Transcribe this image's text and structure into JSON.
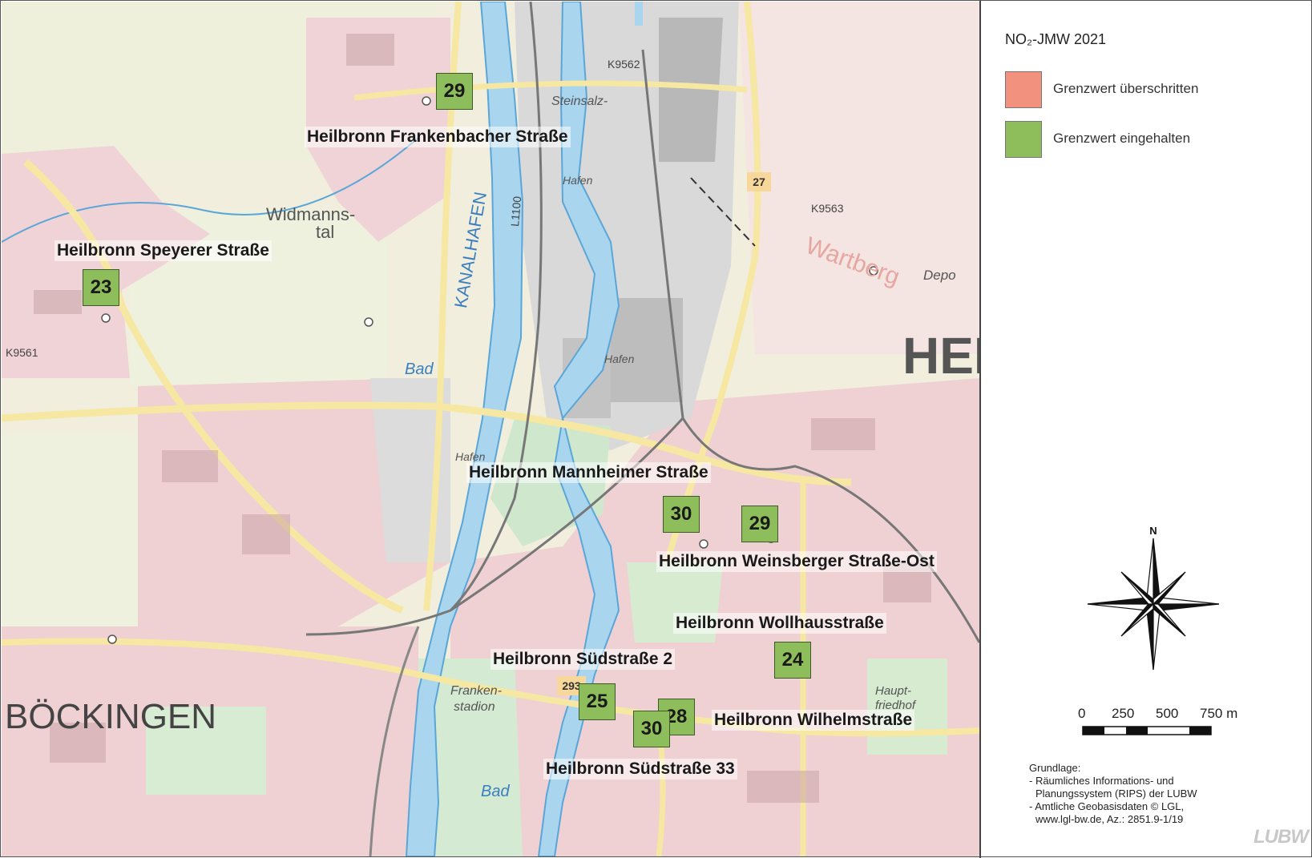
{
  "legend": {
    "title": "NO₂-JMW 2021",
    "items": [
      {
        "label": "Grenzwert überschritten",
        "color": "#f2917e"
      },
      {
        "label": "Grenzwert eingehalten",
        "color": "#8ebd5b"
      }
    ],
    "north": "N",
    "scale": {
      "ticks": [
        "0",
        "250",
        "500",
        "750 m"
      ]
    },
    "source_heading": "Grundlage:",
    "source_lines": [
      "- Räumliches Informations- und",
      "  Planungssystem (RIPS) der LUBW",
      "- Amtliche Geobasisdaten © LGL,",
      "  www.lgl-bw.de, Az.: 2851.9-1/19"
    ],
    "logo": "LUBW"
  },
  "stations": [
    {
      "name": "Heilbronn Frankenbacher Straße",
      "value": "29",
      "status": "Grenzwert eingehalten"
    },
    {
      "name": "Heilbronn Speyerer Straße",
      "value": "23",
      "status": "Grenzwert eingehalten"
    },
    {
      "name": "Heilbronn Mannheimer Straße",
      "value": "30",
      "status": "Grenzwert eingehalten"
    },
    {
      "name": "Heilbronn Weinsberger Straße-Ost",
      "value": "29",
      "status": "Grenzwert eingehalten"
    },
    {
      "name": "Heilbronn Wollhausstraße",
      "value": "24",
      "status": "Grenzwert eingehalten"
    },
    {
      "name": "Heilbronn Südstraße 2",
      "value": "25",
      "status": "Grenzwert eingehalten"
    },
    {
      "name": "Heilbronn Wilhelmstraße",
      "value": "28",
      "status": "Grenzwert eingehalten"
    },
    {
      "name": "Heilbronn Südstraße 33",
      "value": "30",
      "status": "Grenzwert eingehalten"
    }
  ],
  "map_text": {
    "district_boeckingen": "BÖCKINGEN",
    "city_partial": "HEI",
    "kanalhafen": "KANALHAFEN",
    "widmannstal": "Widmanns-",
    "widmannstal2": "tal",
    "bad1": "Bad",
    "bad2": "Bad",
    "hafen1": "Hafen",
    "hafen2": "Hafen",
    "hafen3": "Hafen",
    "frankenstadion": "Franken-",
    "frankenstadion2": "stadion",
    "steinsalzbergwerk": "Steinsalz-",
    "road_k9562": "K9562",
    "road_k9561": "K9561",
    "road_k9563": "K9563",
    "road_l1100": "L1100",
    "road_27": "27",
    "road_293": "293",
    "wartberg": "Wartberg",
    "depot": "Depo",
    "hauptfriedhof": "Haupt-",
    "hauptfriedhof2": "friedhof"
  }
}
